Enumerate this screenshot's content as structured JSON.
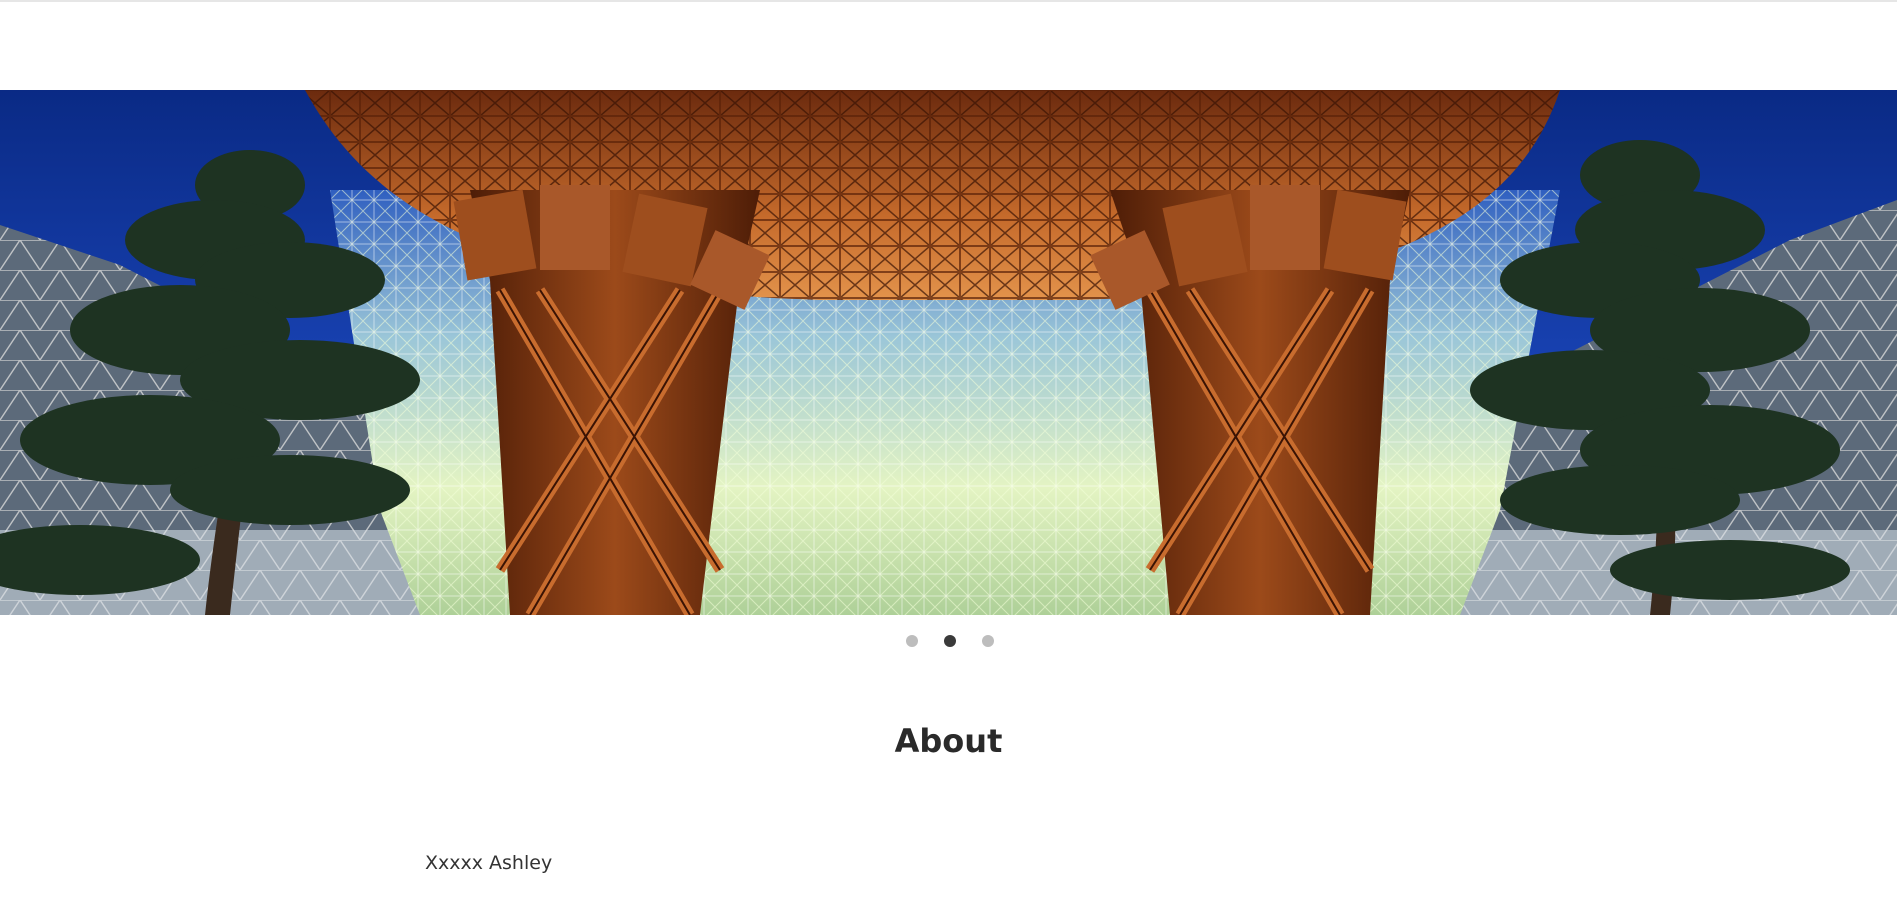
{
  "carousel": {
    "slides": 3,
    "active_index": 1,
    "image_description": "Tsuzumi gate wooden structure"
  },
  "about": {
    "title": "About",
    "name": "Xxxxx Ashley"
  },
  "colors": {
    "sky": "#0c2f8f",
    "wood": "#8a3e12",
    "glass": "#c9e7a8",
    "tree": "#1f3524",
    "dot_inactive": "#bdbdbd",
    "dot_active": "#3a3a3a"
  }
}
